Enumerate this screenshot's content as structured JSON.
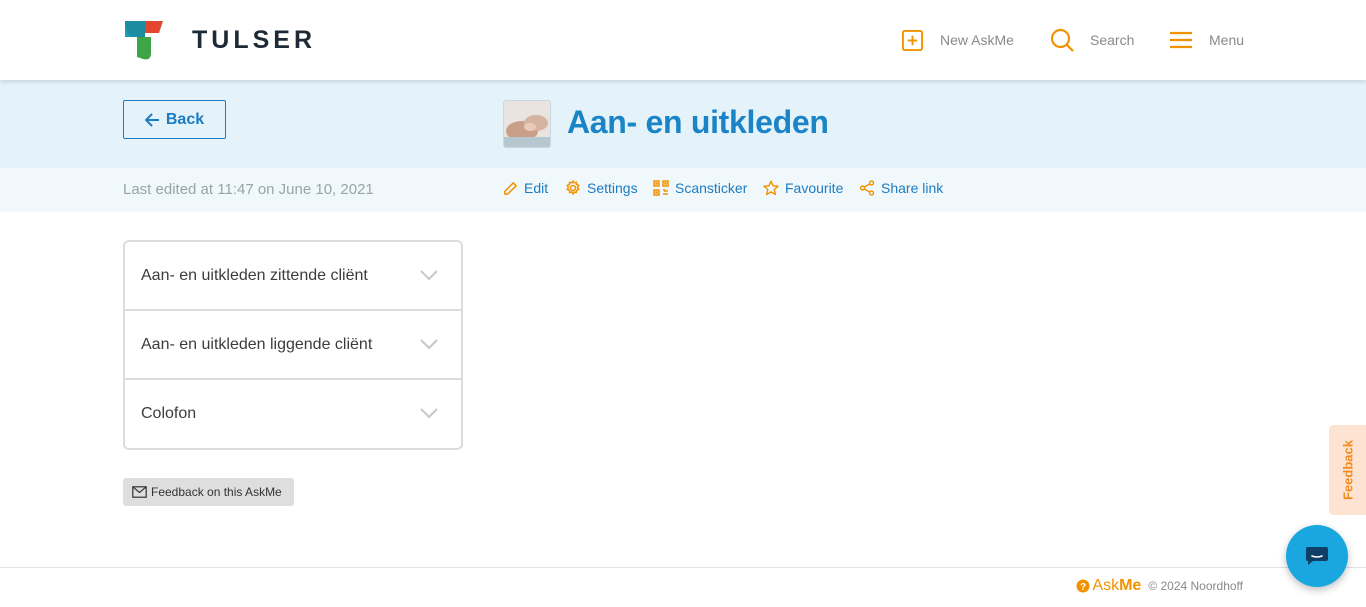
{
  "header": {
    "brand": "TULSER",
    "nav": {
      "new_askme": "New AskMe",
      "search": "Search",
      "menu": "Menu"
    }
  },
  "title_band": {
    "back_label": "Back",
    "title": "Aan- en uitkleden"
  },
  "action_bar": {
    "last_edited": "Last edited at 11:47 on June 10, 2021",
    "edit": "Edit",
    "settings": "Settings",
    "scansticker": "Scansticker",
    "favourite": "Favourite",
    "share_link": "Share link"
  },
  "accordion": {
    "items": [
      {
        "label": "Aan- en uitkleden zittende cliënt"
      },
      {
        "label": "Aan- en uitkleden liggende cliënt"
      },
      {
        "label": "Colofon"
      }
    ]
  },
  "feedback_button": "Feedback on this AskMe",
  "feedback_tab": "Feedback",
  "footer": {
    "logo_ask": "Ask",
    "logo_me": "Me",
    "copyright": "© 2024 Noordhoff"
  },
  "colors": {
    "accent_orange": "#f29200",
    "primary_blue": "#1a84c7",
    "band_bg": "#e4f2f9",
    "chat_blue": "#1aa7e0"
  },
  "icons": {
    "new": "plus-square-icon",
    "search": "search-icon",
    "menu": "hamburger-icon",
    "back": "arrow-left-icon",
    "edit": "pencil-icon",
    "settings": "gear-icon",
    "scansticker": "qr-code-icon",
    "favourite": "star-icon",
    "share": "share-icon",
    "chevron": "chevron-down-icon",
    "mail": "envelope-icon",
    "chat": "chat-bubble-icon"
  }
}
